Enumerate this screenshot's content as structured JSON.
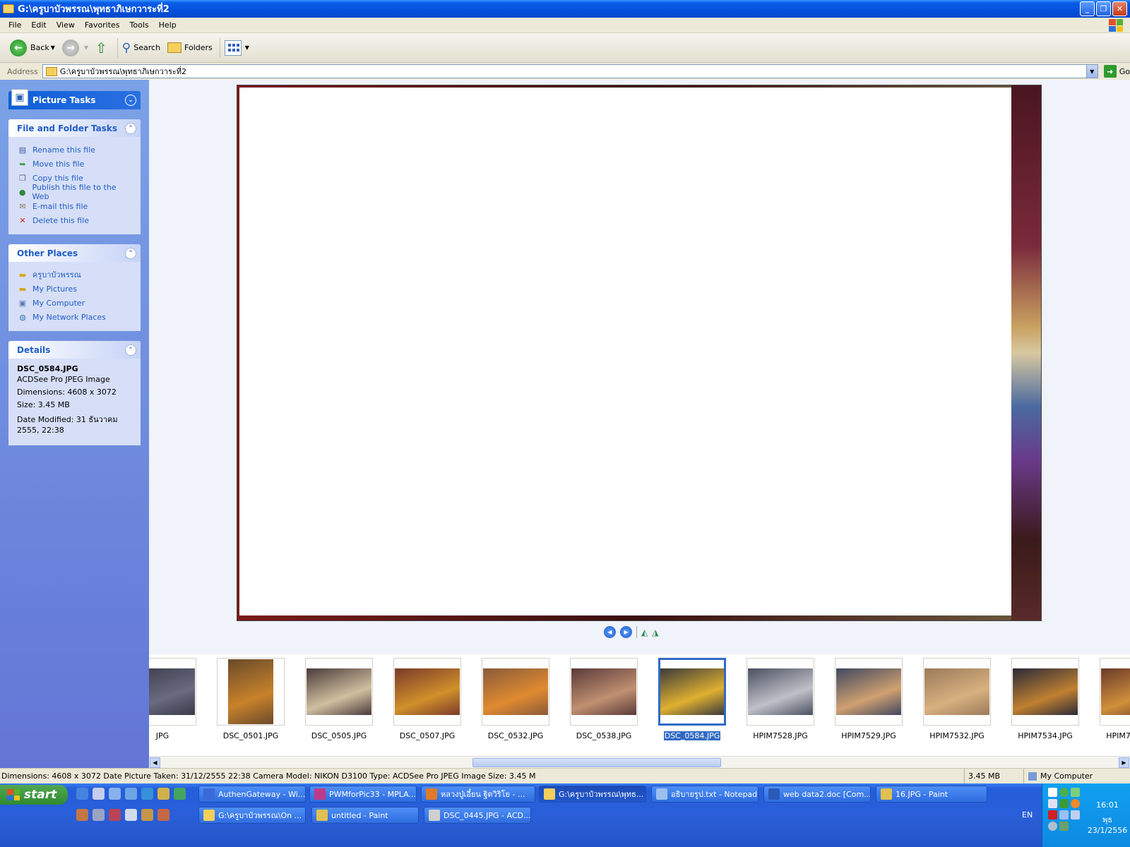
{
  "window": {
    "title": "G:\\ครูบาบัวพรรณ\\พุทธาภิเษกวาระที่2"
  },
  "menu": [
    "File",
    "Edit",
    "View",
    "Favorites",
    "Tools",
    "Help"
  ],
  "toolbar": {
    "back": "Back",
    "search": "Search",
    "folders": "Folders"
  },
  "address": {
    "label": "Address",
    "value": "G:\\ครูบาบัวพรรณ\\พุทธาภิเษกวาระที่2",
    "go": "Go"
  },
  "leftpane": {
    "picture_tasks": "Picture Tasks",
    "file_folder_tasks": {
      "title": "File and Folder Tasks",
      "items": [
        "Rename this file",
        "Move this file",
        "Copy this file",
        "Publish this file to the Web",
        "E-mail this file",
        "Delete this file"
      ]
    },
    "other_places": {
      "title": "Other Places",
      "items": [
        "ครูบาบัวพรรณ",
        "My Pictures",
        "My Computer",
        "My Network Places"
      ]
    },
    "details": {
      "title": "Details",
      "filename": "DSC_0584.JPG",
      "type": "ACDSee Pro JPEG Image",
      "dimensions": "Dimensions: 4608 x 3072",
      "size": "Size: 3.45 MB",
      "modified": "Date Modified: 31 ธันวาคม 2555, 22:38"
    }
  },
  "filmstrip": [
    {
      "label": "JPG",
      "colors": [
        "#3a3a4a",
        "#6a6a80"
      ]
    },
    {
      "label": "DSC_0501.JPG",
      "colors": [
        "#6a4a2a",
        "#c8822a"
      ]
    },
    {
      "label": "DSC_0505.JPG",
      "colors": [
        "#4a3a3a",
        "#d0c0a0"
      ]
    },
    {
      "label": "DSC_0507.JPG",
      "colors": [
        "#7a3a2a",
        "#d0902a"
      ]
    },
    {
      "label": "DSC_0532.JPG",
      "colors": [
        "#8a5a3a",
        "#e08a30"
      ]
    },
    {
      "label": "DSC_0538.JPG",
      "colors": [
        "#5a3a3a",
        "#c09070"
      ]
    },
    {
      "label": "DSC_0584.JPG",
      "colors": [
        "#3a3a3a",
        "#e0b030"
      ]
    },
    {
      "label": "HPIM7528.JPG",
      "colors": [
        "#4a5060",
        "#c0c0c8"
      ]
    },
    {
      "label": "HPIM7529.JPG",
      "colors": [
        "#404860",
        "#d0a070"
      ]
    },
    {
      "label": "HPIM7532.JPG",
      "colors": [
        "#9a7a5a",
        "#d8b080"
      ]
    },
    {
      "label": "HPIM7534.JPG",
      "colors": [
        "#2a2a3a",
        "#c08030"
      ]
    },
    {
      "label": "HPIM7535.JPG",
      "colors": [
        "#6a3a2a",
        "#d0903a"
      ]
    }
  ],
  "selected_index": 6,
  "status": {
    "main": "Dimensions: 4608 x 3072 Date Picture Taken: 31/12/2555 22:38 Camera Model: NIKON D3100 Type: ACDSee Pro JPEG Image Size: 3.45 M",
    "size": "3.45 MB",
    "zone": "My Computer"
  },
  "taskbar": {
    "start": "start",
    "row1": [
      {
        "label": "AuthenGateway - Wi...",
        "color": "#3a6ad8"
      },
      {
        "label": "PWMforPic33 - MPLA...",
        "color": "#c03a8a"
      },
      {
        "label": "หลวงปู่เอี๋ยน ฐิตวิริโย - ...",
        "color": "#e07a2a"
      },
      {
        "label": "G:\\ครูบาบัวพรรณ\\พุทธ...",
        "color": "#f3cf5c"
      },
      {
        "label": "อธิบายรูป.txt - Notepad",
        "color": "#9ac0f0"
      },
      {
        "label": "web data2.doc [Com...",
        "color": "#2a5ab8"
      },
      {
        "label": "16.JPG - Paint",
        "color": "#e0c050"
      }
    ],
    "row2": [
      {
        "label": "G:\\ครูบาบัวพรรณ\\On ...",
        "color": "#f3cf5c"
      },
      {
        "label": "untitled - Paint",
        "color": "#e0c050"
      },
      {
        "label": "DSC_0445.JPG - ACD...",
        "color": "#d0d0d0"
      }
    ],
    "active_row1": 3,
    "lang": "EN",
    "time": "16:01",
    "day": "พุธ",
    "date": "23/1/2556"
  }
}
